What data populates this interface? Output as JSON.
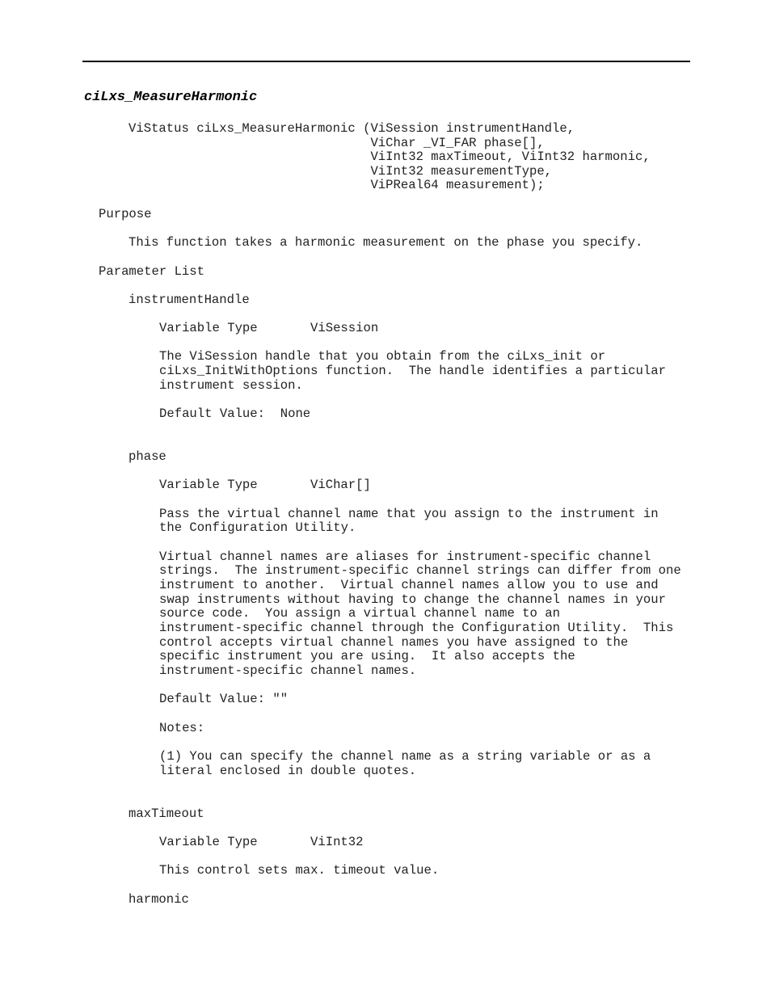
{
  "document": {
    "function_title": "ciLxs_MeasureHarmonic",
    "prototype": [
      "ViStatus ciLxs_MeasureHarmonic (ViSession instrumentHandle,",
      "                                ViChar _VI_FAR phase[],",
      "                                ViInt32 maxTimeout, ViInt32 harmonic,",
      "                                ViInt32 measurementType,",
      "                                ViPReal64 measurement);"
    ],
    "purpose_heading": "Purpose",
    "purpose_text": "This function takes a harmonic measurement on the phase you specify.",
    "parameter_list_heading": "Parameter List",
    "variable_type_label": "Variable Type",
    "parameters": [
      {
        "name": "instrumentHandle",
        "type": "ViSession",
        "description": [
          "The ViSession handle that you obtain from the ciLxs_init or",
          "ciLxs_InitWithOptions function.  The handle identifies a particular",
          "instrument session."
        ],
        "default": "Default Value:  None"
      },
      {
        "name": "phase",
        "type": "ViChar[]",
        "description": [
          "Pass the virtual channel name that you assign to the instrument in",
          "the Configuration Utility."
        ],
        "description2": [
          "Virtual channel names are aliases for instrument-specific channel",
          "strings.  The instrument-specific channel strings can differ from one",
          "instrument to another.  Virtual channel names allow you to use and",
          "swap instruments without having to change the channel names in your",
          "source code.  You assign a virtual channel name to an",
          "instrument-specific channel through the Configuration Utility.  This",
          "control accepts virtual channel names you have assigned to the",
          "specific instrument you are using.  It also accepts the",
          "instrument-specific channel names."
        ],
        "default": "Default Value: \"\"",
        "notes_label": "Notes:",
        "notes": [
          "(1) You can specify the channel name as a string variable or as a",
          "literal enclosed in double quotes."
        ]
      },
      {
        "name": "maxTimeout",
        "type": "ViInt32",
        "description": [
          "This control sets max. timeout value."
        ]
      },
      {
        "name": "harmonic"
      }
    ]
  }
}
